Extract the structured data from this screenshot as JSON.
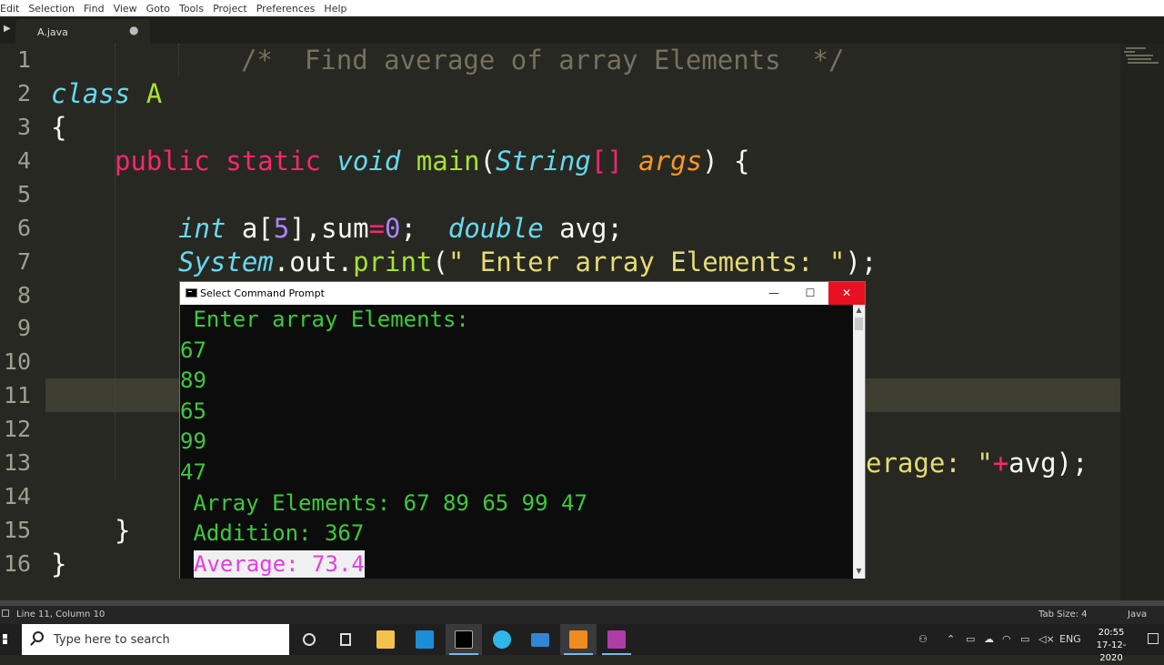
{
  "menu": [
    "Edit",
    "Selection",
    "Find",
    "View",
    "Goto",
    "Tools",
    "Project",
    "Preferences",
    "Help"
  ],
  "tab": {
    "label": "A.java",
    "modified_dot": "●"
  },
  "editor": {
    "line_numbers": [
      "1",
      "2",
      "3",
      "4",
      "5",
      "6",
      "7",
      "8",
      "9",
      "10",
      "11",
      "12",
      "13",
      "14",
      "15",
      "16"
    ],
    "comment_line": "/*  Find average of array Elements  */",
    "class_kw": "class",
    "class_name": "A",
    "open_brace": "{",
    "main_public": "public",
    "main_static": "static",
    "main_void": "void",
    "main_name": "main",
    "main_paren_open": "(",
    "main_string": "String",
    "main_brackets": "[]",
    "main_args": "args",
    "main_tail": ") {",
    "l6_int": "int",
    "l6_a": " a[",
    "l6_5": "5",
    "l6_sum": "],sum",
    "l6_eq": "=",
    "l6_0": "0",
    "l6_semi": ";  ",
    "l6_double": "double",
    "l6_avg": " avg;",
    "l7_system": "System",
    "l7_out": ".out.",
    "l7_print": "print",
    "l7_paren": "(",
    "l7_str": "\" Enter array Elements: \"",
    "l7_end": ");",
    "l13_str": "erage: \"",
    "l13_plus": "+",
    "l13_end": "avg);",
    "l15_brace": "}",
    "l16_brace": "}"
  },
  "statusbar": {
    "position": "Line 11, Column 10",
    "tab_size": "Tab Size: 4",
    "syntax": "Java"
  },
  "cmd": {
    "title": "Select Command Prompt",
    "minimize": "—",
    "maximize": "☐",
    "close": "✕",
    "lines": [
      " Enter array Elements:",
      "67",
      "89",
      "65",
      "99",
      "47",
      " Array Elements: 67 89 65 99 47",
      " Addition: 367",
      "Average: 73.4"
    ]
  },
  "taskbar": {
    "search_placeholder": "Type here to search",
    "language": "ENG",
    "time": "20:55",
    "date": "17-12-2020"
  },
  "colors": {
    "editor_bg": "#272822",
    "keyword": "#f92672",
    "type": "#66d9ef",
    "function": "#a6e22e",
    "string": "#e6db74",
    "number": "#ae81ff",
    "console_text": "#3acc3a",
    "selection_text": "#e040e0",
    "close_button": "#e81123"
  }
}
